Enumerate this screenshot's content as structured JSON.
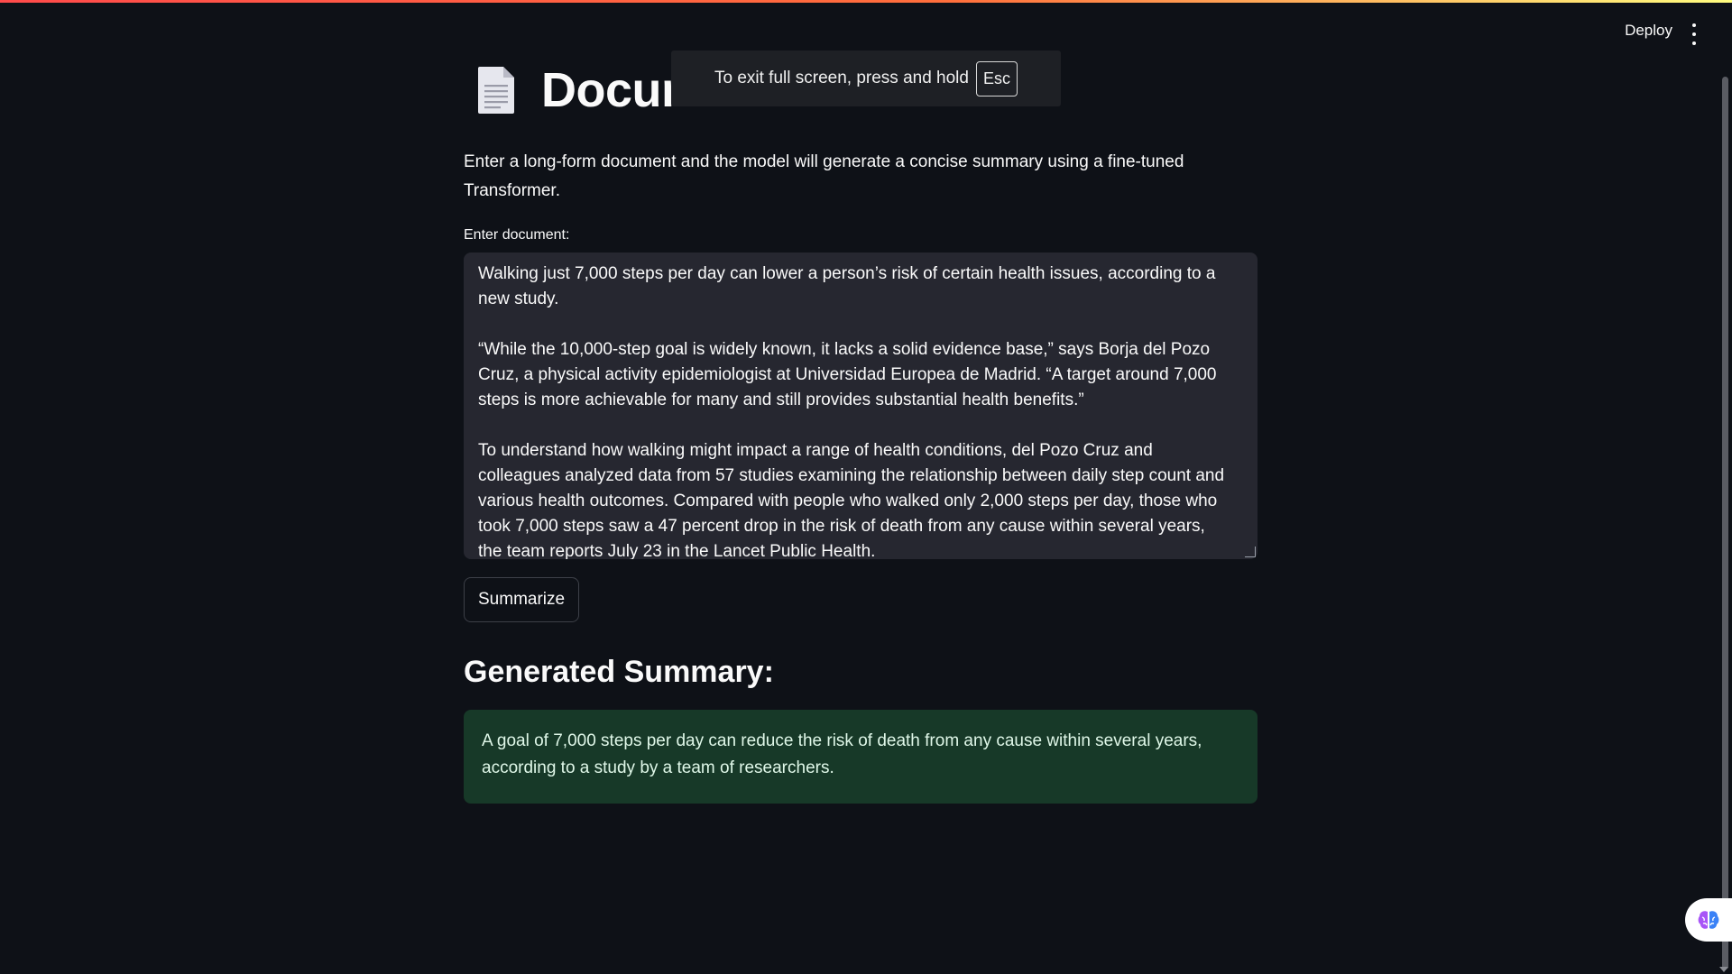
{
  "header": {
    "deploy_label": "Deploy",
    "menu_icon": "more-vertical-icon"
  },
  "fullscreen_notice": {
    "text": "To exit full screen, press and hold",
    "key": "Esc"
  },
  "page": {
    "title_icon": "document-icon",
    "title_visible": "Docum",
    "intro": "Enter a long-form document and the model will generate a concise summary using a fine-tuned Transformer."
  },
  "document_input": {
    "label": "Enter document:",
    "paragraphs": [
      "Walking just 7,000 steps per day can lower a person’s risk of certain health issues, according to a new study.",
      "“While the 10,000-step goal is widely known, it lacks a solid evidence base,” says Borja del Pozo Cruz, a physical activity epidemiologist at Universidad Europea de Madrid. “A target around 7,000 steps is more achievable for many and still provides substantial health benefits.”",
      "To understand how walking might impact a range of health conditions, del Pozo Cruz and colleagues analyzed data from 57 studies examining the relationship between daily step count and various health outcomes. Compared with people who walked only 2,000 steps per day, those who took 7,000 steps saw a 47 percent drop in the risk of death from any cause within several years, the team reports July 23 in the Lancet Public Health."
    ]
  },
  "actions": {
    "summarize_label": "Summarize"
  },
  "summary": {
    "heading": "Generated Summary:",
    "text": "A goal of 7,000 steps per day can reduce the risk of death from any cause within several years, according to a study by a team of researchers."
  },
  "colors": {
    "background": "#0e1117",
    "input_bg": "#262730",
    "success_bg": "#173928",
    "accent_stripe": "#ff4b4b"
  }
}
